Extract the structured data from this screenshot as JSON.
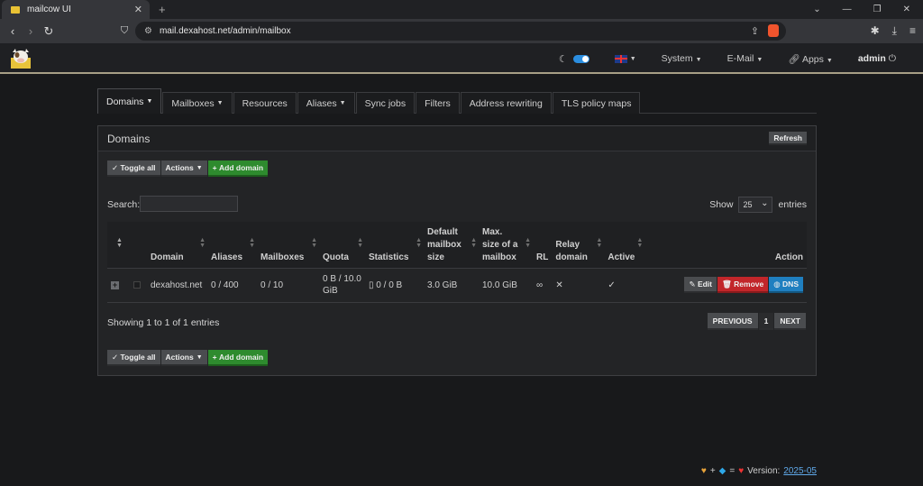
{
  "browser": {
    "tab_title": "mailcow UI",
    "url": "mail.dexahost.net/admin/mailbox"
  },
  "navbar": {
    "system": "System",
    "email": "E-Mail",
    "apps": "Apps",
    "user": "admin"
  },
  "tabs": [
    "Domains",
    "Mailboxes",
    "Resources",
    "Aliases",
    "Sync jobs",
    "Filters",
    "Address rewriting",
    "TLS policy maps"
  ],
  "panel": {
    "title": "Domains",
    "refresh": "Refresh",
    "toggle_all": "Toggle all",
    "actions": "Actions",
    "add_domain": "Add domain",
    "search_label": "Search:",
    "show_label": "Show",
    "show_value": "25",
    "entries_label": "entries"
  },
  "table": {
    "headers": {
      "domain": "Domain",
      "aliases": "Aliases",
      "mailboxes": "Mailboxes",
      "quota": "Quota",
      "statistics": "Statistics",
      "default_size_1": "Default",
      "default_size_2": "mailbox",
      "default_size_3": "size",
      "max_size_1": "Max.",
      "max_size_2": "size of a",
      "max_size_3": "mailbox",
      "rl": "RL",
      "relay_1": "Relay",
      "relay_2": "domain",
      "active": "Active",
      "action": "Action"
    },
    "row": {
      "domain": "dexahost.net",
      "aliases": "0 / 400",
      "mailboxes": "0 / 10",
      "quota_1": "0 B / 10.0",
      "quota_2": "GiB",
      "statistics": "0 / 0 B",
      "default_size": "3.0 GiB",
      "max_size": "10.0 GiB",
      "rl": "∞",
      "relay": "✕",
      "active": "✓",
      "edit": "Edit",
      "remove": "Remove",
      "dns": "DNS"
    }
  },
  "info": "Showing 1 to 1 of 1 entries",
  "pager": {
    "previous": "PREVIOUS",
    "current": "1",
    "next": "NEXT"
  },
  "footer": {
    "eq": "=",
    "plus": "+",
    "version_label": "Version:",
    "version": "2025-05"
  }
}
